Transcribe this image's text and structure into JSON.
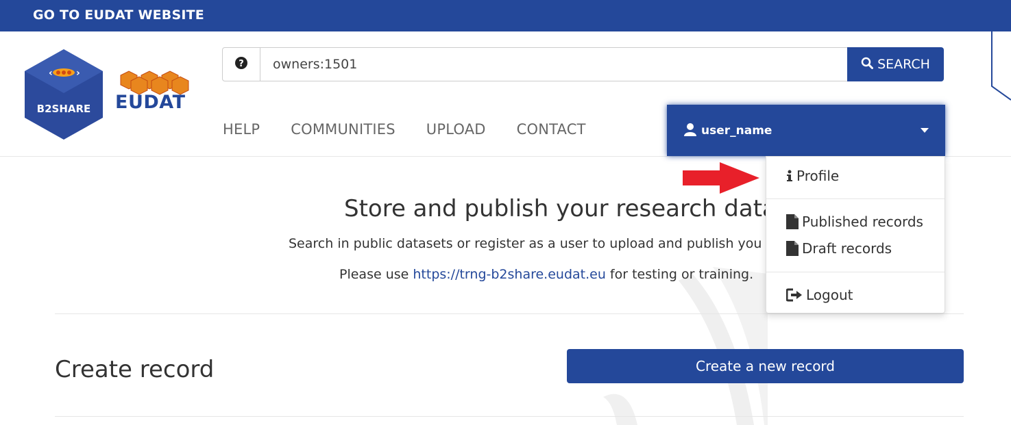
{
  "topbar": {
    "link_label": "GO TO EUDAT WEBSITE"
  },
  "logos": {
    "b2share": "B2SHARE",
    "eudat": "EUDAT"
  },
  "search": {
    "value": "owners:1501",
    "placeholder": "",
    "button_label": "SEARCH"
  },
  "nav": {
    "items": [
      {
        "label": "HELP"
      },
      {
        "label": "COMMUNITIES"
      },
      {
        "label": "UPLOAD"
      },
      {
        "label": "CONTACT"
      }
    ]
  },
  "user_menu": {
    "username": "user_name",
    "items": [
      {
        "label": "Profile",
        "icon": "info-icon"
      },
      {
        "label": "Published records",
        "icon": "file-icon"
      },
      {
        "label": "Draft records",
        "icon": "file-icon"
      },
      {
        "label": "Logout",
        "icon": "logout-icon"
      }
    ]
  },
  "hero": {
    "title": "Store and publish your research data",
    "subtitle": "Search in public datasets or register as a user to upload and publish you",
    "note_prefix": "Please use ",
    "note_link": "https://trng-b2share.eudat.eu",
    "note_suffix": " for testing or training."
  },
  "create": {
    "title": "Create record",
    "button_label": "Create a new record"
  },
  "colors": {
    "brand": "#24489a",
    "annotation_arrow": "#e8202a"
  }
}
